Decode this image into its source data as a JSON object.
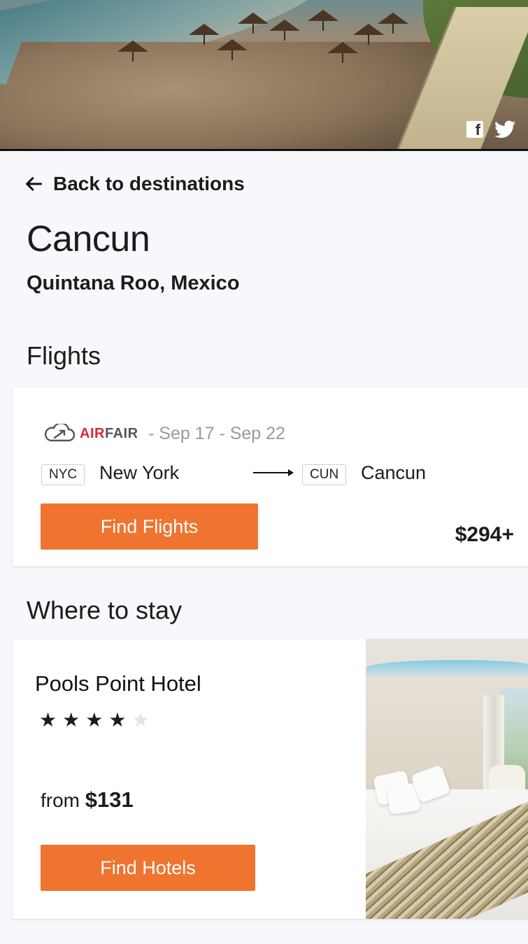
{
  "hero": {
    "share": {
      "facebook_icon": "facebook-icon",
      "twitter_icon": "twitter-icon"
    }
  },
  "nav": {
    "back_label": "Back to destinations"
  },
  "destination": {
    "city": "Cancun",
    "region": "Quintana Roo, Mexico"
  },
  "flights": {
    "section_title": "Flights",
    "airline": {
      "name_part1": "AIR",
      "name_part2": "FAIR"
    },
    "dates": "- Sep 17 - Sep 22",
    "origin": {
      "code": "NYC",
      "city": "New York"
    },
    "destination": {
      "code": "CUN",
      "city": "Cancun"
    },
    "button_label": "Find Flights",
    "price": "$294+"
  },
  "stay": {
    "section_title": "Where to stay",
    "hotel": {
      "name": "Pools Point Hotel",
      "rating": 4,
      "rating_max": 5,
      "price_prefix": "from",
      "price": "$131",
      "button_label": "Find Hotels"
    }
  },
  "colors": {
    "accent": "#ee7430",
    "brand_red": "#d8283a"
  }
}
